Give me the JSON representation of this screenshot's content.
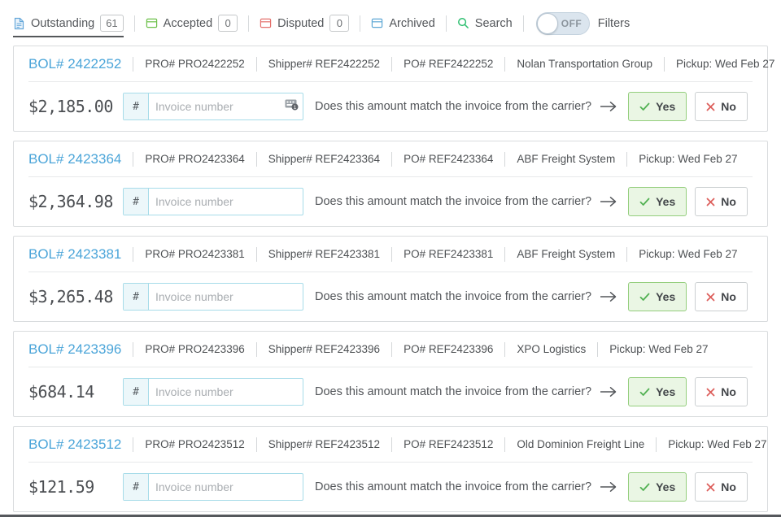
{
  "tabs": {
    "outstanding": {
      "label": "Outstanding",
      "count": "61"
    },
    "accepted": {
      "label": "Accepted",
      "count": "0"
    },
    "disputed": {
      "label": "Disputed",
      "count": "0"
    },
    "archived": {
      "label": "Archived"
    },
    "search": {
      "label": "Search"
    }
  },
  "filters": {
    "toggle_state": "OFF",
    "label": "Filters"
  },
  "invoice_prompt": {
    "prefix": "#",
    "placeholder": "Invoice number",
    "question": "Does this amount match the invoice from the carrier?",
    "yes_label": "Yes",
    "no_label": "No"
  },
  "colors": {
    "bol_link": "#4ba5d9",
    "outstanding_icon": "#64a7d9",
    "accepted_icon": "#6cc04a",
    "disputed_icon": "#e4716d",
    "archived_icon": "#5fa8d5",
    "search_icon": "#2fbf71",
    "yes_green": "#52b153",
    "no_red": "#dd5f5c",
    "input_border": "#a7dce9"
  },
  "shipments": [
    {
      "bol": "BOL# 2422252",
      "pro": "PRO# PRO2422252",
      "shipper": "Shipper# REF2422252",
      "po": "PO# REF2422252",
      "carrier": "Nolan Transportation Group",
      "pickup": "Pickup: Wed Feb 27",
      "amount": "$2,185.00",
      "invoice_value": ""
    },
    {
      "bol": "BOL# 2423364",
      "pro": "PRO# PRO2423364",
      "shipper": "Shipper# REF2423364",
      "po": "PO# REF2423364",
      "carrier": "ABF Freight System",
      "pickup": "Pickup: Wed Feb 27",
      "amount": "$2,364.98",
      "invoice_value": ""
    },
    {
      "bol": "BOL# 2423381",
      "pro": "PRO# PRO2423381",
      "shipper": "Shipper# REF2423381",
      "po": "PO# REF2423381",
      "carrier": "ABF Freight System",
      "pickup": "Pickup: Wed Feb 27",
      "amount": "$3,265.48",
      "invoice_value": ""
    },
    {
      "bol": "BOL# 2423396",
      "pro": "PRO# PRO2423396",
      "shipper": "Shipper# REF2423396",
      "po": "PO# REF2423396",
      "carrier": "XPO Logistics",
      "pickup": "Pickup: Wed Feb 27",
      "amount": "$684.14",
      "invoice_value": ""
    },
    {
      "bol": "BOL# 2423512",
      "pro": "PRO# PRO2423512",
      "shipper": "Shipper# REF2423512",
      "po": "PO# REF2423512",
      "carrier": "Old Dominion Freight Line",
      "pickup": "Pickup: Wed Feb 27",
      "amount": "$121.59",
      "invoice_value": ""
    }
  ]
}
